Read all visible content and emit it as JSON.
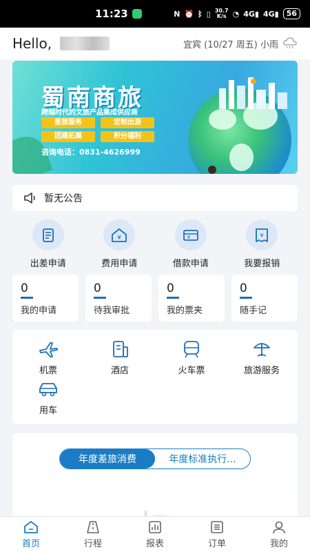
{
  "status_bar": {
    "time": "11:23",
    "net_speed_top": "30.7",
    "net_speed_bottom": "K/s",
    "battery": "56"
  },
  "header": {
    "greeting": "Hello,",
    "weather_text": "宜宾 (10/27 周五) 小雨",
    "weather_icon": "rain-cloud-icon"
  },
  "banner": {
    "title": "蜀南商旅",
    "subtitle": "跨越时代的文旅产品集成供应商",
    "tags": [
      "差旅服务",
      "定制出游",
      "团建拓展",
      "积分福利"
    ],
    "phone": "咨询电话：0831-4626999"
  },
  "notice": {
    "text": "暂无公告",
    "icon": "speaker-icon"
  },
  "actions": [
    {
      "label": "出差申请",
      "icon": "document-icon"
    },
    {
      "label": "费用申请",
      "icon": "yuan-house-icon"
    },
    {
      "label": "借款申请",
      "icon": "yuan-card-icon"
    },
    {
      "label": "我要报销",
      "icon": "reimburse-icon"
    }
  ],
  "stats": [
    {
      "value": "0",
      "label": "我的申请"
    },
    {
      "value": "0",
      "label": "待我审批"
    },
    {
      "value": "0",
      "label": "我的票夹"
    },
    {
      "value": "0",
      "label": "随手记"
    }
  ],
  "services": [
    {
      "label": "机票",
      "icon": "plane-icon"
    },
    {
      "label": "酒店",
      "icon": "hotel-icon"
    },
    {
      "label": "火车票",
      "icon": "train-icon"
    },
    {
      "label": "旅游服务",
      "icon": "beach-umbrella-icon"
    },
    {
      "label": "用车",
      "icon": "car-icon"
    }
  ],
  "report": {
    "tabs": [
      "年度差旅消费",
      "年度标准执行..."
    ],
    "active_tab": 0
  },
  "bottom_nav": [
    {
      "label": "首页",
      "icon": "home-icon",
      "active": true
    },
    {
      "label": "行程",
      "icon": "road-icon",
      "active": false
    },
    {
      "label": "报表",
      "icon": "chart-icon",
      "active": false
    },
    {
      "label": "订单",
      "icon": "list-icon",
      "active": false
    },
    {
      "label": "我的",
      "icon": "user-icon",
      "active": false
    }
  ],
  "colors": {
    "accent": "#1a7cc4",
    "background": "#f2f4f8",
    "tag_yellow": "#f5c318"
  }
}
